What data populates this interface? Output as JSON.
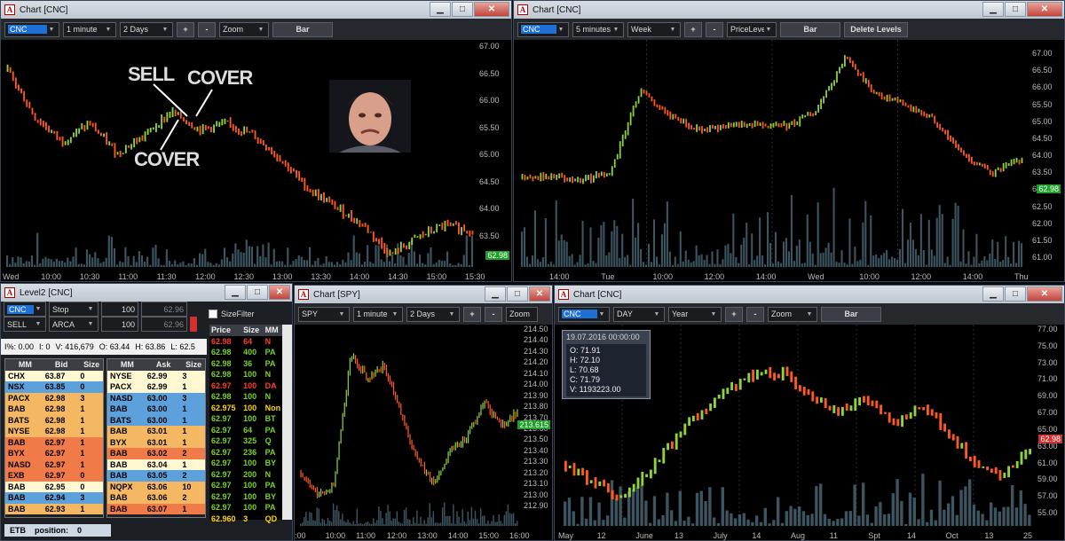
{
  "windows": {
    "w1": {
      "title": "Chart [CNC]",
      "toolbar": {
        "symbol": "CNC",
        "interval": "1 minute",
        "range": "2 Days",
        "plus": "+",
        "minus": "-",
        "mode": "Zoom",
        "type": "Bar"
      },
      "y_ticks": [
        "67.00",
        "66.50",
        "66.00",
        "65.50",
        "65.00",
        "64.50",
        "64.00",
        "63.50"
      ],
      "x_ticks": [
        "Wed",
        "10:00",
        "10:30",
        "11:00",
        "11:30",
        "12:00",
        "12:30",
        "13:00",
        "13:30",
        "14:00",
        "14:30",
        "15:00",
        "15:30"
      ],
      "last_price": "62.98",
      "annotations": {
        "sell": "SELL",
        "cover_top": "COVER",
        "cover_bottom": "COVER"
      },
      "colors": {
        "sell": "#ffffff",
        "cover_top": "#ff5a1e",
        "cover_bottom": "#8fd23a"
      }
    },
    "w2": {
      "title": "Chart [CNC]",
      "toolbar": {
        "symbol": "CNC",
        "interval": "5 minutes",
        "range": "Week",
        "plus": "+",
        "minus": "-",
        "mode": "PriceLeve",
        "type": "Bar",
        "delete": "Delete Levels"
      },
      "y_ticks": [
        "67.00",
        "66.50",
        "66.00",
        "65.50",
        "65.00",
        "64.50",
        "64.00",
        "63.50",
        "63.00",
        "62.50",
        "62.00",
        "61.50",
        "61.00"
      ],
      "x_ticks": [
        "14:00",
        "Tue",
        "10:00",
        "12:00",
        "14:00",
        "Wed",
        "10:00",
        "12:00",
        "14:00",
        "Thu"
      ],
      "last_price": "62.98"
    },
    "level2": {
      "title": "Level2 [CNC]",
      "symbol": "CNC",
      "order_type": "Stop",
      "qty1": "100",
      "price1": "62.96",
      "side": "SELL",
      "route": "ARCA",
      "qty2": "100",
      "price2": "62.96",
      "info": {
        "pct": "I%: 0.00",
        "i": "I: 0",
        "volume": "V: 416,679",
        "open": "O: 63.44",
        "high": "H: 63.86",
        "low": "L: 62.5"
      },
      "size_filter": "SizeFilter",
      "bid_headers": [
        "MM",
        "Bid",
        "Size"
      ],
      "ask_headers": [
        "MM",
        "Ask",
        "Size"
      ],
      "tape_headers": [
        "Price",
        "Size",
        "MM"
      ],
      "bids": [
        {
          "mm": "CHX",
          "price": "63.87",
          "size": "0",
          "color": "#fff8d0"
        },
        {
          "mm": "NSX",
          "price": "63.85",
          "size": "0",
          "color": "#5ca0dc"
        },
        {
          "mm": "PACX",
          "price": "62.98",
          "size": "3",
          "color": "#f4b862"
        },
        {
          "mm": "BAB",
          "price": "62.98",
          "size": "1",
          "color": "#f4b862"
        },
        {
          "mm": "BATS",
          "price": "62.98",
          "size": "1",
          "color": "#f4b862"
        },
        {
          "mm": "NYSE",
          "price": "62.98",
          "size": "1",
          "color": "#f4b862"
        },
        {
          "mm": "BAB",
          "price": "62.97",
          "size": "1",
          "color": "#f07a48"
        },
        {
          "mm": "BYX",
          "price": "62.97",
          "size": "1",
          "color": "#f07a48"
        },
        {
          "mm": "NASD",
          "price": "62.97",
          "size": "1",
          "color": "#f07a48"
        },
        {
          "mm": "EXB",
          "price": "62.97",
          "size": "0",
          "color": "#f07a48"
        },
        {
          "mm": "BAB",
          "price": "62.95",
          "size": "0",
          "color": "#fff8d0"
        },
        {
          "mm": "BAB",
          "price": "62.94",
          "size": "3",
          "color": "#5ca0dc"
        },
        {
          "mm": "BAB",
          "price": "62.93",
          "size": "1",
          "color": "#f4b862"
        }
      ],
      "asks": [
        {
          "mm": "NYSE",
          "price": "62.99",
          "size": "3",
          "color": "#fff8d0"
        },
        {
          "mm": "PACX",
          "price": "62.99",
          "size": "1",
          "color": "#fff8d0"
        },
        {
          "mm": "NASD",
          "price": "63.00",
          "size": "3",
          "color": "#5ca0dc"
        },
        {
          "mm": "BAB",
          "price": "63.00",
          "size": "1",
          "color": "#5ca0dc"
        },
        {
          "mm": "BATS",
          "price": "63.00",
          "size": "1",
          "color": "#5ca0dc"
        },
        {
          "mm": "BAB",
          "price": "63.01",
          "size": "1",
          "color": "#f4b862"
        },
        {
          "mm": "BYX",
          "price": "63.01",
          "size": "1",
          "color": "#f4b862"
        },
        {
          "mm": "BAB",
          "price": "63.02",
          "size": "2",
          "color": "#f07a48"
        },
        {
          "mm": "BAB",
          "price": "63.04",
          "size": "1",
          "color": "#fff8d0"
        },
        {
          "mm": "BAB",
          "price": "63.05",
          "size": "2",
          "color": "#5ca0dc"
        },
        {
          "mm": "NQPX",
          "price": "63.06",
          "size": "10",
          "color": "#f4b862"
        },
        {
          "mm": "BAB",
          "price": "63.06",
          "size": "2",
          "color": "#f4b862"
        },
        {
          "mm": "BAB",
          "price": "63.07",
          "size": "1",
          "color": "#f07a48"
        }
      ],
      "tape": [
        {
          "price": "62.98",
          "size": "64",
          "mm": "N",
          "color": "#ff3b30"
        },
        {
          "price": "62.98",
          "size": "400",
          "mm": "PA",
          "color": "#7ed321"
        },
        {
          "price": "62.98",
          "size": "36",
          "mm": "PA",
          "color": "#7ed321"
        },
        {
          "price": "62.98",
          "size": "100",
          "mm": "N",
          "color": "#7ed321"
        },
        {
          "price": "62.97",
          "size": "100",
          "mm": "DA",
          "color": "#ff3b30"
        },
        {
          "price": "62.98",
          "size": "100",
          "mm": "N",
          "color": "#7ed321"
        },
        {
          "price": "62.975",
          "size": "100",
          "mm": "Non",
          "color": "#ffd700"
        },
        {
          "price": "62.97",
          "size": "100",
          "mm": "BT",
          "color": "#7ed321"
        },
        {
          "price": "62.97",
          "size": "64",
          "mm": "PA",
          "color": "#7ed321"
        },
        {
          "price": "62.97",
          "size": "325",
          "mm": "Q",
          "color": "#7ed321"
        },
        {
          "price": "62.97",
          "size": "236",
          "mm": "PA",
          "color": "#7ed321"
        },
        {
          "price": "62.97",
          "size": "100",
          "mm": "BY",
          "color": "#7ed321"
        },
        {
          "price": "62.97",
          "size": "200",
          "mm": "N",
          "color": "#7ed321"
        },
        {
          "price": "62.97",
          "size": "100",
          "mm": "PA",
          "color": "#7ed321"
        },
        {
          "price": "62.97",
          "size": "100",
          "mm": "BY",
          "color": "#7ed321"
        },
        {
          "price": "62.97",
          "size": "100",
          "mm": "PA",
          "color": "#7ed321"
        },
        {
          "price": "62.960",
          "size": "3",
          "mm": "QD",
          "color": "#ffd700"
        }
      ],
      "footer": {
        "etb": "ETB",
        "position_label": "position:",
        "position_value": "0"
      }
    },
    "w3": {
      "title": "Chart [SPY]",
      "toolbar": {
        "symbol": "SPY",
        "interval": "1 minute",
        "range": "2 Days",
        "plus": "+",
        "minus": "-",
        "mode": "Zoom"
      },
      "y_ticks": [
        "214.50",
        "214.40",
        "214.30",
        "214.20",
        "214.10",
        "214.00",
        "213.90",
        "213.80",
        "213.70",
        "213.60",
        "213.50",
        "213.40",
        "213.30",
        "213.20",
        "213.10",
        "213.00",
        "212.90"
      ],
      "x_ticks": [
        ":00",
        "10:00",
        "11:00",
        "12:00",
        "13:00",
        "14:00",
        "15:00",
        "16:00"
      ],
      "last_price": "213.615"
    },
    "w4": {
      "title": "Chart [CNC]",
      "toolbar": {
        "symbol": "CNC",
        "interval": "DAY",
        "range": "Year",
        "plus": "+",
        "minus": "-",
        "mode": "Zoom",
        "type": "Bar"
      },
      "y_ticks": [
        "77.00",
        "75.00",
        "73.00",
        "71.00",
        "69.00",
        "67.00",
        "65.00",
        "63.00",
        "61.00",
        "59.00",
        "57.00",
        "55.00"
      ],
      "x_ticks": [
        "May",
        "12",
        "June",
        "13",
        "July",
        "14",
        "Aug",
        "11",
        "Spt",
        "14",
        "Oct",
        "13",
        "25"
      ],
      "last_price": "62.98",
      "tooltip": {
        "date": "19.07.2016 00:00:00",
        "o": "O: 71.91",
        "h": "H: 72.10",
        "l": "L: 70.68",
        "c": "C: 71.79",
        "v": "V: 1193223.00"
      }
    }
  },
  "chart_data": [
    {
      "type": "bar",
      "title": "Chart [CNC]",
      "interval": "1 minute",
      "ylim": [
        63.3,
        67.1
      ],
      "x_ticks": [
        "Wed",
        "10:00",
        "10:30",
        "11:00",
        "11:30",
        "12:00",
        "12:30",
        "13:00",
        "13:30",
        "14:00",
        "14:30",
        "15:00",
        "15:30"
      ],
      "close_path": [
        66.6,
        65.8,
        65.4,
        65.7,
        65.2,
        65.5,
        65.9,
        65.6,
        65.7,
        65.5,
        65.1,
        64.6,
        64.3,
        64.0,
        63.5,
        63.8,
        64.0,
        63.9
      ],
      "last": 62.98
    },
    {
      "type": "bar",
      "title": "Chart [CNC]",
      "interval": "5 minutes",
      "ylim": [
        60.9,
        67.2
      ],
      "x_ticks": [
        "14:00",
        "Tue",
        "10:00",
        "12:00",
        "14:00",
        "Wed",
        "10:00",
        "12:00",
        "14:00",
        "Thu"
      ],
      "close_path": [
        63.4,
        63.4,
        63.3,
        63.5,
        65.8,
        65.1,
        64.7,
        64.8,
        64.9,
        64.8,
        65.2,
        66.7,
        65.7,
        65.4,
        65.0,
        64.0,
        63.5,
        63.9
      ],
      "last": 62.98
    },
    {
      "type": "bar",
      "title": "Chart [SPY]",
      "interval": "1 minute",
      "ylim": [
        212.85,
        214.55
      ],
      "x_ticks": [
        ":00",
        "10:00",
        "11:00",
        "12:00",
        "13:00",
        "14:00",
        "15:00",
        "16:00"
      ],
      "close_path": [
        213.3,
        213.1,
        213.2,
        214.3,
        214.1,
        214.2,
        213.8,
        213.4,
        213.2,
        213.5,
        213.6,
        213.9,
        213.7,
        213.8
      ],
      "last": 213.615
    },
    {
      "type": "bar",
      "title": "Chart [CNC]",
      "interval": "DAY",
      "ylim": [
        54.5,
        77.5
      ],
      "x_ticks": [
        "May",
        "12",
        "June",
        "13",
        "July",
        "14",
        "Aug",
        "11",
        "Spt",
        "14",
        "Oct",
        "13",
        "25"
      ],
      "close_path": [
        61.5,
        59.5,
        57.2,
        60.5,
        64.5,
        67.5,
        70.0,
        72.0,
        71.8,
        69.5,
        67.5,
        69.0,
        66.0,
        68.5,
        65.0,
        61.5,
        60.0,
        63.5
      ],
      "last": 62.98
    }
  ]
}
